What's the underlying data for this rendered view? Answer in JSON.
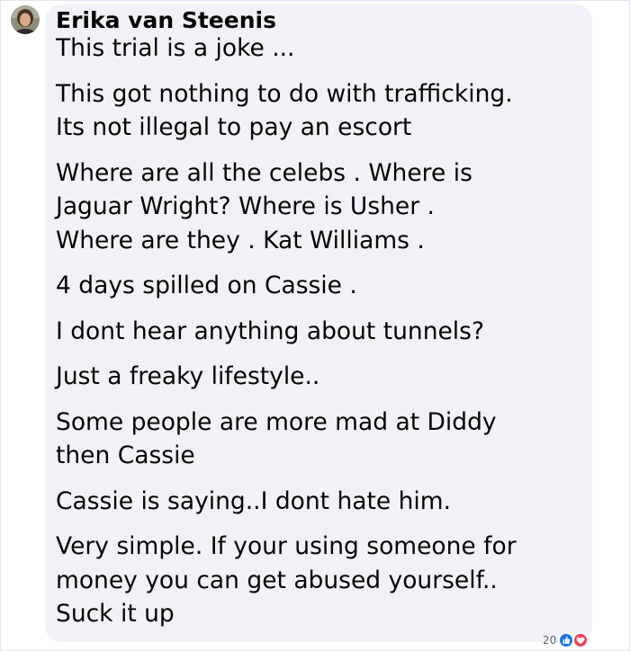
{
  "comment": {
    "author": "Erika van Steenis",
    "paragraphs": [
      [
        "This trial is a joke ..."
      ],
      [
        "This got nothing to do with trafficking.",
        "Its not illegal to pay an escort"
      ],
      [
        "Where are all the celebs . Where is",
        "Jaguar Wright? Where is Usher .",
        "Where are they . Kat Williams ."
      ],
      [
        "4 days spilled on Cassie ."
      ],
      [
        "I dont hear anything about tunnels?"
      ],
      [
        "Just a freaky lifestyle.."
      ],
      [
        "Some people are more mad at Diddy",
        "then Cassie"
      ],
      [
        "Cassie is saying..I dont hate him."
      ],
      [
        "Very simple. If your using someone for",
        "money you can get abused yourself..",
        "Suck it up"
      ]
    ],
    "reactions": {
      "count": "20",
      "icons": [
        "like-icon",
        "love-icon"
      ],
      "like_color": "#1877f2",
      "love_color": "#f33e58"
    }
  },
  "colors": {
    "bubble": "#f0f2f5",
    "text": "#050505",
    "muted": "#65676b"
  }
}
